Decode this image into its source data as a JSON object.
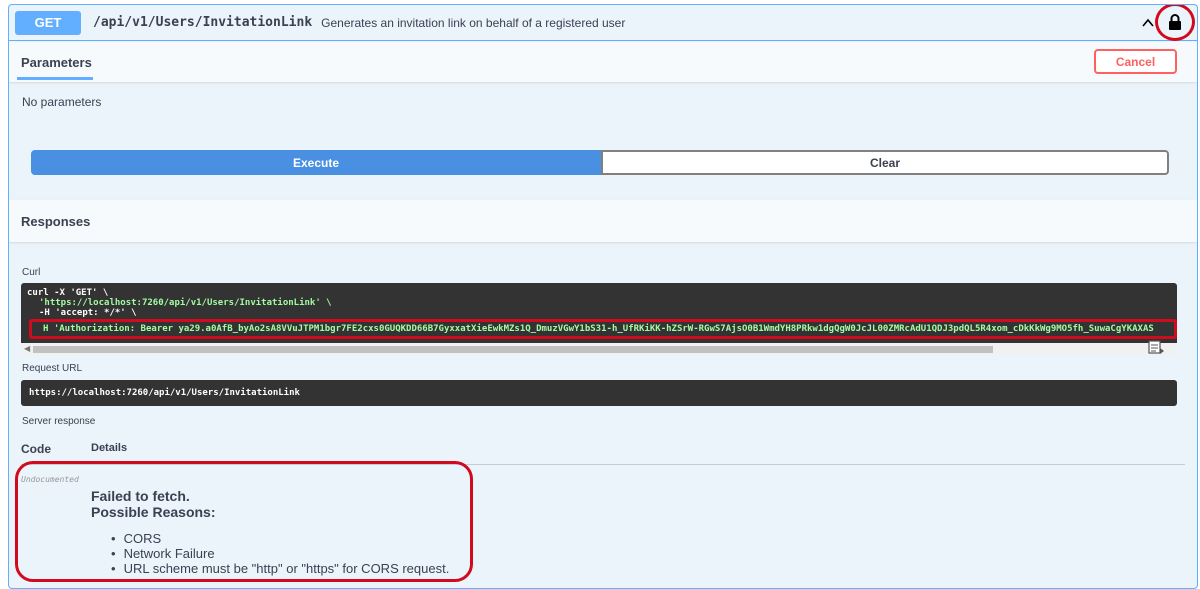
{
  "summary": {
    "method": "GET",
    "path": "/api/v1/Users/InvitationLink",
    "description": "Generates an invitation link on behalf of a registered user"
  },
  "parameters": {
    "tab_label": "Parameters",
    "cancel_label": "Cancel",
    "no_params_text": "No parameters"
  },
  "actions": {
    "execute_label": "Execute",
    "clear_label": "Clear"
  },
  "responses": {
    "heading": "Responses",
    "curl_label": "Curl",
    "curl_lines": [
      "curl -X 'GET' \\",
      "'https://localhost:7260/api/v1/Users/InvitationLink' \\",
      "-H 'accept: */*' \\",
      "H 'Authorization: Bearer ya29.a0AfB_byAo2sA8VVuJTPM1bgr7FE2cxs0GUQKDD66B7GyxxatXieEwkMZs1Q_DmuzVGwY1bS31-h_UfRKiKK-hZSrW-RGwS7AjsO0B1WmdYH8PRkw1dgQgW0JcJL00ZMRcAdU1QDJ3pdQL5R4xom_cDkKkWg9MO5fh_SuwaCgYKAXAS"
    ],
    "request_url_label": "Request URL",
    "request_url": "https://localhost:7260/api/v1/Users/InvitationLink",
    "server_response_label": "Server response",
    "code_header": "Code",
    "details_header": "Details",
    "undocumented_label": "Undocumented",
    "error_title": "Failed to fetch.",
    "error_subtitle": "Possible Reasons:",
    "reasons": [
      "CORS",
      "Network Failure",
      "URL scheme must be \"http\" or \"https\" for CORS request."
    ]
  },
  "colors": {
    "accent": "#61affe",
    "execute": "#4990e2",
    "cancel": "#ff6060",
    "highlight": "#d20a1e",
    "code_bg": "#333333"
  },
  "icons": [
    "chevron-up-icon",
    "lock-icon",
    "copy-to-clipboard-icon",
    "scroll-left-arrow-icon"
  ]
}
